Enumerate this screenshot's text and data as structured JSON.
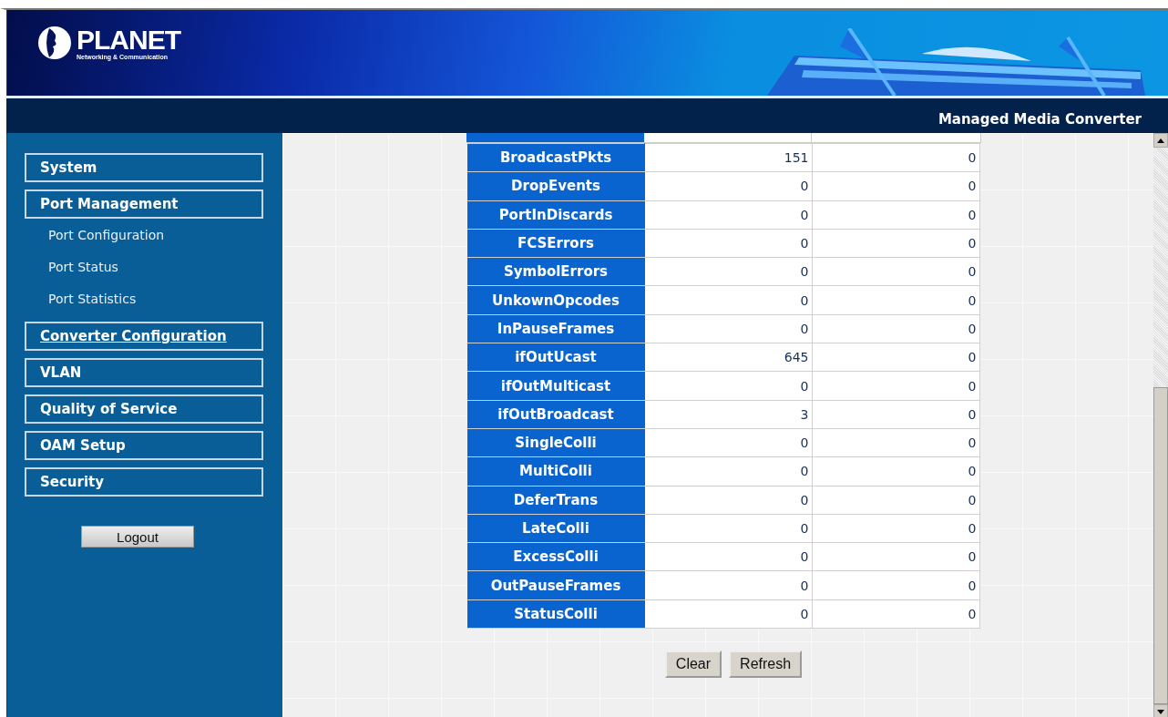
{
  "header": {
    "logo_name": "PLANET",
    "logo_tagline": "Networking & Communication",
    "product_title": "Managed Media Converter"
  },
  "sidebar": {
    "items": [
      {
        "kind": "section",
        "label": "System",
        "hover": false
      },
      {
        "kind": "section",
        "label": "Port Management",
        "hover": false
      },
      {
        "kind": "link",
        "label": "Port Configuration",
        "hover": false
      },
      {
        "kind": "link",
        "label": "Port Status",
        "hover": false
      },
      {
        "kind": "link",
        "label": "Port Statistics",
        "hover": false
      },
      {
        "kind": "section",
        "label": "Converter Configuration",
        "hover": true
      },
      {
        "kind": "section",
        "label": "VLAN",
        "hover": false
      },
      {
        "kind": "section",
        "label": "Quality of Service",
        "hover": false
      },
      {
        "kind": "section",
        "label": "OAM Setup",
        "hover": false
      },
      {
        "kind": "section",
        "label": "Security",
        "hover": false
      }
    ],
    "logout_button": "Logout"
  },
  "statistics_table": {
    "rows": [
      {
        "name": "BroadcastPkts",
        "column_2": "151",
        "column_3": "0"
      },
      {
        "name": "DropEvents",
        "column_2": "0",
        "column_3": "0"
      },
      {
        "name": "PortInDiscards",
        "column_2": "0",
        "column_3": "0"
      },
      {
        "name": "FCSErrors",
        "column_2": "0",
        "column_3": "0"
      },
      {
        "name": "SymbolErrors",
        "column_2": "0",
        "column_3": "0"
      },
      {
        "name": "UnkownOpcodes",
        "column_2": "0",
        "column_3": "0"
      },
      {
        "name": "InPauseFrames",
        "column_2": "0",
        "column_3": "0"
      },
      {
        "name": "ifOutUcast",
        "column_2": "645",
        "column_3": "0"
      },
      {
        "name": "ifOutMulticast",
        "column_2": "0",
        "column_3": "0"
      },
      {
        "name": "ifOutBroadcast",
        "column_2": "3",
        "column_3": "0"
      },
      {
        "name": "SingleColli",
        "column_2": "0",
        "column_3": "0"
      },
      {
        "name": "MultiColli",
        "column_2": "0",
        "column_3": "0"
      },
      {
        "name": "DeferTrans",
        "column_2": "0",
        "column_3": "0"
      },
      {
        "name": "LateColli",
        "column_2": "0",
        "column_3": "0"
      },
      {
        "name": "ExcessColli",
        "column_2": "0",
        "column_3": "0"
      },
      {
        "name": "OutPauseFrames",
        "column_2": "0",
        "column_3": "0"
      },
      {
        "name": "StatusColli",
        "column_2": "0",
        "column_3": "0"
      }
    ]
  },
  "buttons": [
    "Clear",
    "Refresh"
  ]
}
